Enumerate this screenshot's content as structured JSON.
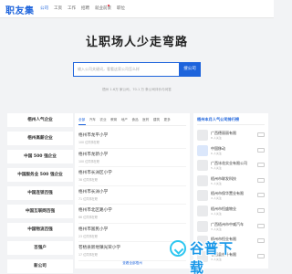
{
  "header": {
    "logo": "职友集",
    "nav": [
      "公司",
      "工资",
      "工作",
      "招聘",
      "就业前景",
      "职位"
    ]
  },
  "hero": {
    "title": "让职场人少走弯路",
    "search_placeholder": "输入公司关键词，看看这家公司怎么样",
    "search_button": "搜公司",
    "stats": "梧州 1.6万 家公司，70.1 万 条公司评价与问答"
  },
  "categories": [
    "梧州人气企业",
    "梧州高薪企业",
    "中国 500 强企业",
    "中国服务业 500 强企业",
    "中国连锁百强",
    "中国互联网百强",
    "中国物流百强",
    "百强户",
    "新公司"
  ],
  "tabs": [
    "全部",
    "汽车",
    "农业",
    "教育",
    "地产",
    "食品",
    "医药",
    "建筑",
    "更多"
  ],
  "companies": [
    {
      "name": "梧州市龙平小学",
      "sub": "100 位同事在职"
    },
    {
      "name": "梧州市龙新小学",
      "sub": "100 位同事在职"
    },
    {
      "name": "梧州市长洲区小学",
      "sub": "38 位同事在职"
    },
    {
      "name": "梧州市长洲小学",
      "sub": "71 位同事在职"
    },
    {
      "name": "梧州市北区路小学",
      "sub": "66 位同事在职"
    },
    {
      "name": "梧州市富民小学",
      "sub": "23 位同事在职"
    },
    {
      "name": "苍梧县新地镇光荣小学",
      "sub": "17 位同事在职"
    }
  ],
  "more_link": "查看全部梧州",
  "hot": {
    "title": "梧州本月人气公司排行榜",
    "items": [
      {
        "name": "广西德丽丽有限",
        "sub": "8 人关注"
      },
      {
        "name": "中国移动",
        "sub": "6 人关注"
      },
      {
        "name": "广西冰花实业有限公司",
        "sub": "5 人关注"
      },
      {
        "name": "梧州市联发科技",
        "sub": "5 人关注"
      },
      {
        "name": "梧州市保华置业有限",
        "sub": "4 人关注"
      },
      {
        "name": "梧州市恒盛物业",
        "sub": "4 人关注"
      },
      {
        "name": "广西梧州市中威汽车",
        "sub": "3 人关注"
      },
      {
        "name": "梧州市恒业有限",
        "sub": "3 人关注"
      },
      {
        "name": "苍梧县茶叶有限",
        "sub": "3 人关注"
      }
    ]
  },
  "watermark": "谷普下载",
  "colors": {
    "accent": "#1e64dc",
    "bg": "#f2f3f5"
  }
}
